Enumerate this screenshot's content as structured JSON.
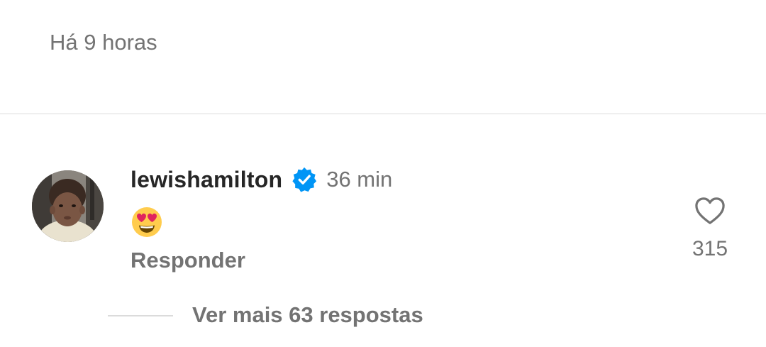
{
  "post": {
    "time": "Há 9 horas"
  },
  "comment": {
    "username": "lewishamilton",
    "verified": true,
    "time": "36 min",
    "emoji": "smiling-face-with-heart-eyes",
    "reply_label": "Responder",
    "like_count": "315",
    "view_replies_label": "Ver mais 63 respostas"
  },
  "icons": {
    "verified": "verified-badge-icon",
    "like": "heart-outline-icon"
  },
  "colors": {
    "primary_text": "#262626",
    "secondary_text": "#737373",
    "verified_blue": "#0095f6",
    "divider": "#dbdbdb",
    "emoji_yellow": "#ffcc4d",
    "emoji_heart": "#e0245e"
  }
}
